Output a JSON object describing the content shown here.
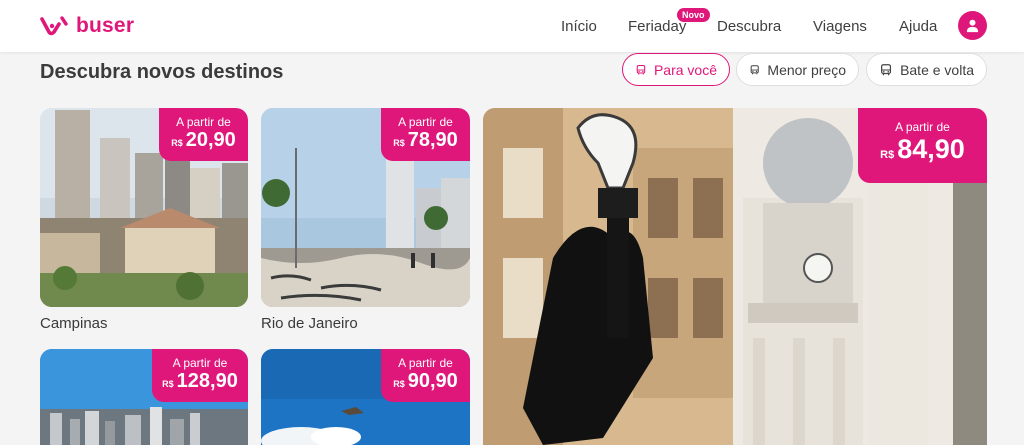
{
  "brand": {
    "name": "buser",
    "color": "#e0177a"
  },
  "nav": {
    "items": [
      {
        "label": "Início"
      },
      {
        "label": "Feriaday"
      },
      {
        "label": "Descubra"
      },
      {
        "label": "Viagens"
      },
      {
        "label": "Ajuda"
      }
    ],
    "badge": "Novo",
    "profile_icon": "user-icon"
  },
  "section": {
    "title": "Descubra novos destinos"
  },
  "filters": [
    {
      "label": "Para você",
      "icon": "bus-icon",
      "active": true
    },
    {
      "label": "Menor preço",
      "icon": "bus-icon",
      "active": false
    },
    {
      "label": "Bate e volta",
      "icon": "bus-icon",
      "active": false
    }
  ],
  "price_prefix": "A partir de",
  "currency": "R$",
  "destinations": [
    {
      "city": "Campinas",
      "price": "20,90"
    },
    {
      "city": "Rio de Janeiro",
      "price": "78,90"
    },
    {
      "city": "",
      "price": "84,90"
    },
    {
      "city": "",
      "price": "128,90"
    },
    {
      "city": "",
      "price": "90,90"
    }
  ]
}
